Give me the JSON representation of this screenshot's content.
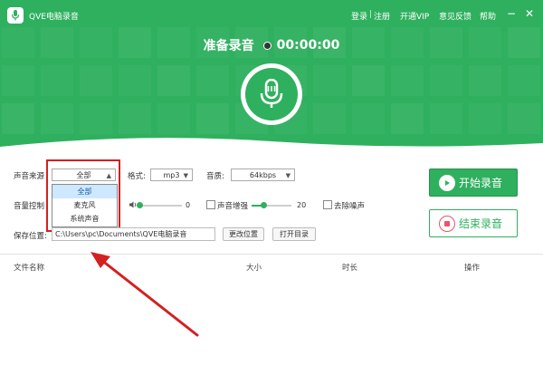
{
  "app": {
    "title": "QVE电脑录音"
  },
  "top_links": {
    "login": "登录",
    "sep": "|",
    "register": "注册",
    "vip": "开通VIP",
    "feedback": "意见反馈",
    "help": "帮助"
  },
  "window": {
    "minimize": "−",
    "close": "✕"
  },
  "status": {
    "text": "准备录音",
    "time": "00:00:00"
  },
  "controls": {
    "source_label": "声音来源",
    "source_value": "全部",
    "source_options": [
      "全部",
      "麦克风",
      "系统声音"
    ],
    "format_label": "格式:",
    "format_value": "mp3",
    "quality_label": "音质:",
    "quality_value": "64kbps",
    "volume_label": "音量控制",
    "volume_value": "0",
    "boost_label": "声音增强",
    "boost_value": "20",
    "denoise_label": "去除噪声",
    "save_label": "保存位置:",
    "save_path": "C:\\Users\\pc\\Documents\\QVE电脑录音",
    "change_path": "更改位置",
    "open_dir": "打开目录"
  },
  "actions": {
    "start": "开始录音",
    "stop": "结束录音"
  },
  "table": {
    "columns": [
      "文件名称",
      "大小",
      "时长",
      "操作"
    ]
  },
  "colors": {
    "brand": "#2fb05f",
    "annotation": "#d42020",
    "stop_icon": "#e8546a"
  }
}
